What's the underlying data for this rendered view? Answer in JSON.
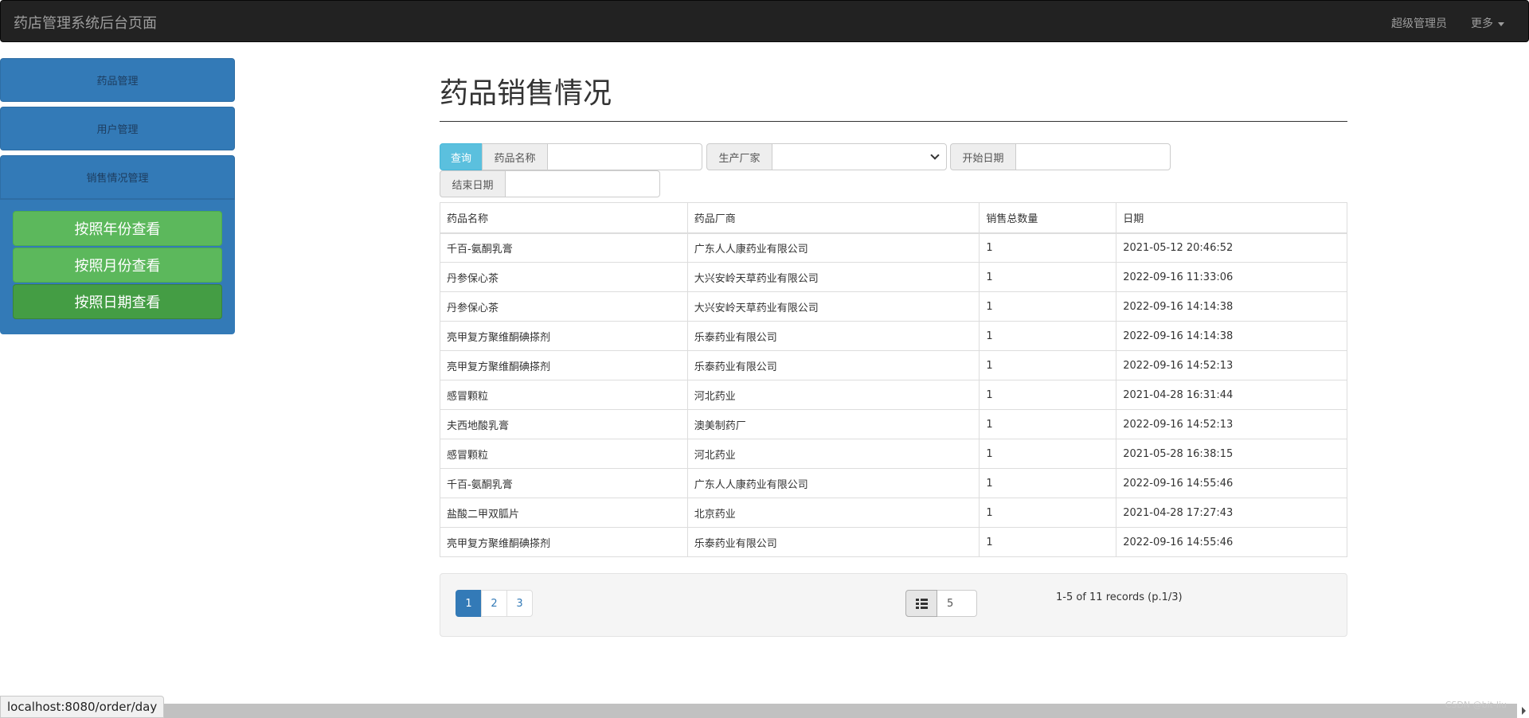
{
  "navbar": {
    "brand": "药店管理系统后台页面",
    "user": "超级管理员",
    "more": "更多"
  },
  "sidebar": {
    "items": [
      {
        "label": "药品管理"
      },
      {
        "label": "用户管理"
      },
      {
        "label": "销售情况管理"
      }
    ],
    "submenu": [
      {
        "label": "按照年份查看"
      },
      {
        "label": "按照月份查看"
      },
      {
        "label": "按照日期查看"
      }
    ]
  },
  "main": {
    "title": "药品销售情况",
    "filters": {
      "query_button": "查询",
      "drug_name_label": "药品名称",
      "drug_name_value": "",
      "manufacturer_label": "生产厂家",
      "manufacturer_value": "",
      "start_date_label": "开始日期",
      "start_date_value": "",
      "end_date_label": "结束日期",
      "end_date_value": ""
    },
    "table": {
      "headers": [
        "药品名称",
        "药品厂商",
        "销售总数量",
        "日期"
      ],
      "rows": [
        [
          "千百-氨酮乳膏",
          "广东人人康药业有限公司",
          "1",
          "2021-05-12 20:46:52"
        ],
        [
          "丹参保心茶",
          "大兴安岭天草药业有限公司",
          "1",
          "2022-09-16 11:33:06"
        ],
        [
          "丹参保心茶",
          "大兴安岭天草药业有限公司",
          "1",
          "2022-09-16 14:14:38"
        ],
        [
          "亮甲复方聚维酮碘搽剂",
          "乐泰药业有限公司",
          "1",
          "2022-09-16 14:14:38"
        ],
        [
          "亮甲复方聚维酮碘搽剂",
          "乐泰药业有限公司",
          "1",
          "2022-09-16 14:52:13"
        ],
        [
          "感冒颗粒",
          "河北药业",
          "1",
          "2021-04-28 16:31:44"
        ],
        [
          "夫西地酸乳膏",
          "澳美制药厂",
          "1",
          "2022-09-16 14:52:13"
        ],
        [
          "感冒颗粒",
          "河北药业",
          "1",
          "2021-05-28 16:38:15"
        ],
        [
          "千百-氨酮乳膏",
          "广东人人康药业有限公司",
          "1",
          "2022-09-16 14:55:46"
        ],
        [
          "盐酸二甲双胍片",
          "北京药业",
          "1",
          "2021-04-28 17:27:43"
        ],
        [
          "亮甲复方聚维酮碘搽剂",
          "乐泰药业有限公司",
          "1",
          "2022-09-16 14:55:46"
        ]
      ]
    },
    "pager": {
      "pages": [
        "1",
        "2",
        "3"
      ],
      "current_page": "1",
      "page_size": "5",
      "records_text": "1-5 of 11 records (p.1/3)"
    }
  },
  "statusbar": {
    "url": "localhost:8080/order/day"
  },
  "watermark": "CSDN @bit-liu",
  "colors": {
    "primary": "#337ab7",
    "success": "#5cb85c",
    "info": "#5bc0de",
    "navbar": "#222222"
  }
}
